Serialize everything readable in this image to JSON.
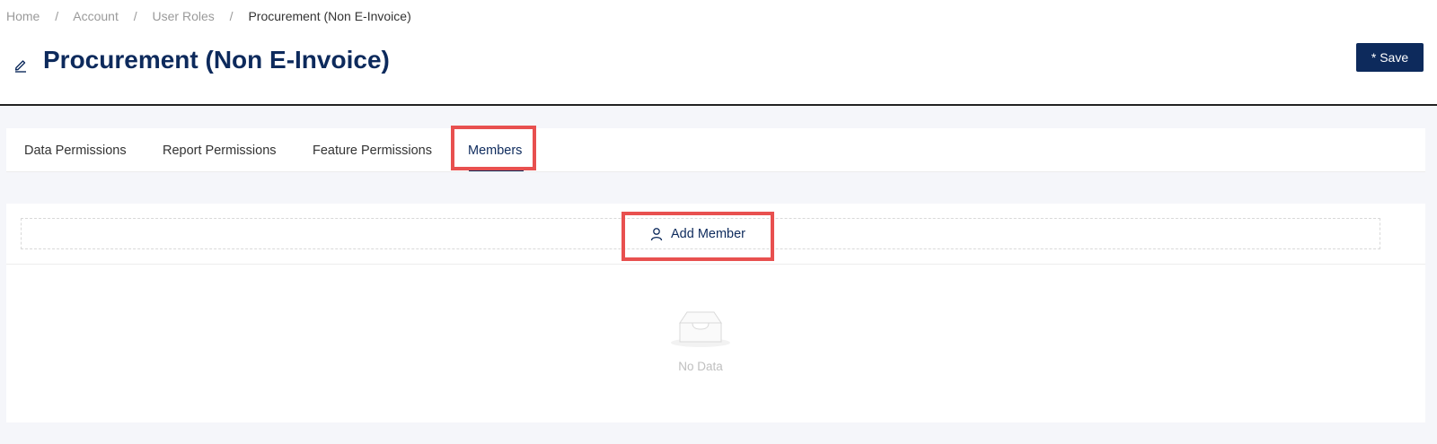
{
  "breadcrumb": {
    "items": [
      "Home",
      "Account",
      "User Roles",
      "Procurement (Non E-Invoice)"
    ],
    "separator": "/"
  },
  "page": {
    "title": "Procurement (Non E-Invoice)",
    "save_label": "* Save"
  },
  "tabs": [
    {
      "label": "Data Permissions",
      "active": false
    },
    {
      "label": "Report Permissions",
      "active": false
    },
    {
      "label": "Feature Permissions",
      "active": false
    },
    {
      "label": "Members",
      "active": true
    }
  ],
  "members": {
    "add_label": "Add Member",
    "empty_text": "No Data"
  },
  "colors": {
    "primary": "#0d2a5c",
    "highlight": "#e8504f",
    "background": "#f5f6fa"
  },
  "icons": [
    "edit-icon",
    "user-icon",
    "empty-inbox-icon"
  ]
}
